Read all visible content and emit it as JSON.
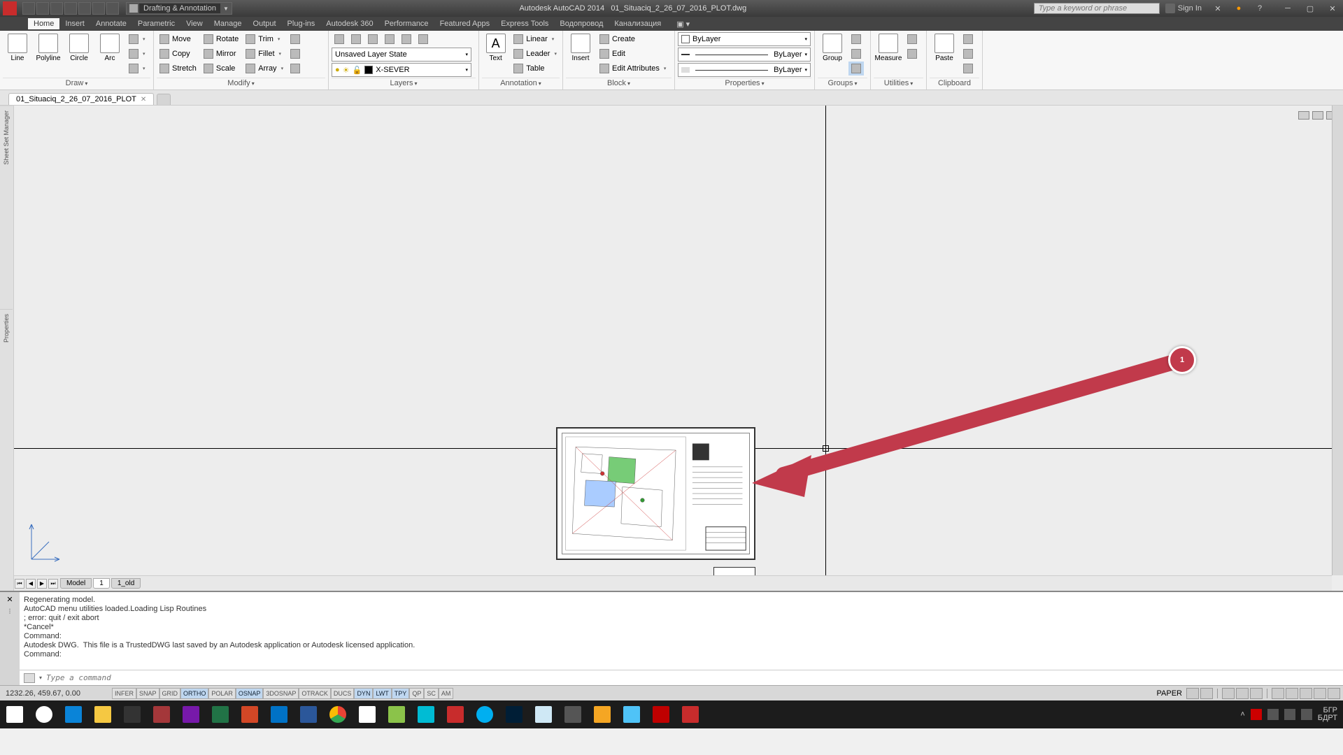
{
  "titlebar": {
    "workspace": "Drafting & Annotation",
    "app": "Autodesk AutoCAD 2014",
    "filename": "01_Situaciq_2_26_07_2016_PLOT.dwg",
    "search_placeholder": "Type a keyword or phrase",
    "signin": "Sign In"
  },
  "menu": {
    "tabs": [
      "Home",
      "Insert",
      "Annotate",
      "Parametric",
      "View",
      "Manage",
      "Output",
      "Plug-ins",
      "Autodesk 360",
      "Featured Apps",
      "Express Tools",
      "Водопровод",
      "Канализация",
      "Performance"
    ]
  },
  "ribbon": {
    "draw": {
      "title": "Draw",
      "line": "Line",
      "polyline": "Polyline",
      "circle": "Circle",
      "arc": "Arc"
    },
    "modify": {
      "title": "Modify",
      "move": "Move",
      "rotate": "Rotate",
      "trim": "Trim",
      "copy": "Copy",
      "mirror": "Mirror",
      "fillet": "Fillet",
      "stretch": "Stretch",
      "scale": "Scale",
      "array": "Array"
    },
    "layers": {
      "title": "Layers",
      "state": "Unsaved Layer State",
      "current": "X-SEVER"
    },
    "annotation": {
      "title": "Annotation",
      "text": "Text",
      "linear": "Linear",
      "leader": "Leader",
      "table": "Table"
    },
    "block": {
      "title": "Block",
      "insert": "Insert",
      "create": "Create",
      "edit": "Edit",
      "editattr": "Edit Attributes"
    },
    "properties": {
      "title": "Properties",
      "bylayer1": "ByLayer",
      "bylayer2": "ByLayer",
      "bylayer3": "ByLayer"
    },
    "groups": {
      "title": "Groups",
      "group": "Group"
    },
    "utilities": {
      "title": "Utilities",
      "measure": "Measure"
    },
    "clipboard": {
      "title": "Clipboard",
      "paste": "Paste"
    }
  },
  "doctab": {
    "name": "01_Situaciq_2_26_07_2016_PLOT"
  },
  "side": {
    "sheet": "Sheet Set Manager",
    "props": "Properties"
  },
  "layout": {
    "model": "Model",
    "l1": "1",
    "l1old": "1_old"
  },
  "cmd": {
    "line1": "Regenerating model.",
    "line2": "AutoCAD menu utilities loaded.Loading Lisp Routines",
    "line3": "; error: quit / exit abort",
    "line4": "*Cancel*",
    "line5": "Command:",
    "line6": "Autodesk DWG.  This file is a TrustedDWG last saved by an Autodesk application or Autodesk licensed application.",
    "line7": "Command:",
    "placeholder": "Type a command"
  },
  "status": {
    "coords": "1232.26, 459.67, 0.00",
    "toggles": [
      "INFER",
      "SNAP",
      "GRID",
      "ORTHO",
      "POLAR",
      "OSNAP",
      "3DOSNAP",
      "OTRACK",
      "DUCS",
      "DYN",
      "LWT",
      "TPY",
      "QP",
      "SC",
      "AM"
    ],
    "paper": "PAPER"
  },
  "tray": {
    "lang1": "БГР",
    "lang2": "БДРТ"
  },
  "anno": {
    "badge": "1"
  }
}
